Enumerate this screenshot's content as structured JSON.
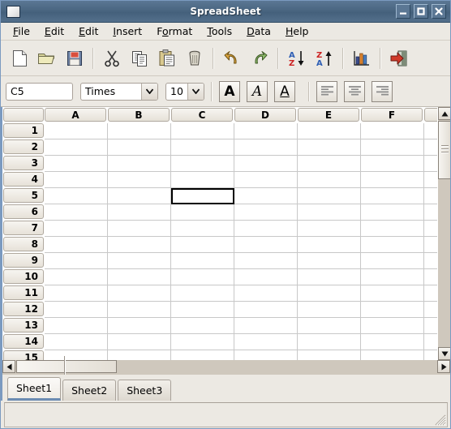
{
  "window": {
    "title": "SpreadSheet",
    "icon": "window-icon",
    "buttons": {
      "minimize": "minimize-icon",
      "maximize": "maximize-icon",
      "close": "close-icon"
    }
  },
  "menubar": {
    "items": [
      {
        "label": "File",
        "mnemonic": "F"
      },
      {
        "label": "Edit",
        "mnemonic": "E"
      },
      {
        "label": "Edit",
        "mnemonic": "E"
      },
      {
        "label": "Insert",
        "mnemonic": "I"
      },
      {
        "label": "Format",
        "mnemonic": "o"
      },
      {
        "label": "Tools",
        "mnemonic": "T"
      },
      {
        "label": "Data",
        "mnemonic": "D"
      },
      {
        "label": "Help",
        "mnemonic": "H"
      }
    ]
  },
  "toolbar": {
    "groups": [
      [
        "new-document-icon",
        "open-folder-icon",
        "save-floppy-icon"
      ],
      [
        "cut-scissors-icon",
        "copy-icon",
        "paste-icon",
        "delete-trash-icon"
      ],
      [
        "undo-icon",
        "redo-icon"
      ],
      [
        "sort-ascending-icon",
        "sort-descending-icon"
      ],
      [
        "chart-icon"
      ],
      [
        "exit-door-icon"
      ]
    ],
    "labels": {
      "new-document-icon": "New",
      "open-folder-icon": "Open",
      "save-floppy-icon": "Save",
      "cut-scissors-icon": "Cut",
      "copy-icon": "Copy",
      "paste-icon": "Paste",
      "delete-trash-icon": "Delete",
      "undo-icon": "Undo",
      "redo-icon": "Redo",
      "sort-ascending-icon": "Sort Ascending",
      "sort-descending-icon": "Sort Descending",
      "chart-icon": "Chart",
      "exit-door-icon": "Exit"
    }
  },
  "formatbar": {
    "cell_reference": "C5",
    "font_name": "Times",
    "font_size": "10",
    "bold_label": "A",
    "italic_label": "A",
    "underline_label": "A",
    "align_left": "align-left-icon",
    "align_center": "align-center-icon",
    "align_right": "align-right-icon"
  },
  "sheet": {
    "columns": [
      "A",
      "B",
      "C",
      "D",
      "E",
      "F"
    ],
    "rows": [
      "1",
      "2",
      "3",
      "4",
      "5",
      "6",
      "7",
      "8",
      "9",
      "10",
      "11",
      "12",
      "13",
      "14",
      "15"
    ],
    "selected_cell": "C5",
    "selected_col_index": 2,
    "selected_row_index": 4,
    "cell_values": []
  },
  "tabs": {
    "items": [
      "Sheet1",
      "Sheet2",
      "Sheet3"
    ],
    "active": "Sheet1"
  },
  "statusbar": {
    "text": ""
  },
  "colors": {
    "titlebar": "#4a6681",
    "window_border": "#7b9ac0",
    "chrome": "#ece9e3",
    "grid_line": "#c8c8c8",
    "selection": "#000000",
    "tab_active_underline": "#6b8cb3"
  }
}
